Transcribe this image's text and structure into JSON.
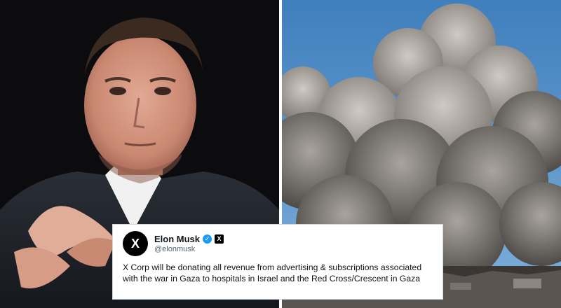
{
  "tweet": {
    "display_name": "Elon Musk",
    "handle": "@elonmusk",
    "avatar_letter": "X",
    "affiliation_badge": "X",
    "verified_color": "#1d9bf0",
    "text": "X Corp will be donating all revenue from advertising & subscriptions associated with the war in Gaza to hospitals in Israel and the Red Cross/Crescent in Gaza"
  }
}
